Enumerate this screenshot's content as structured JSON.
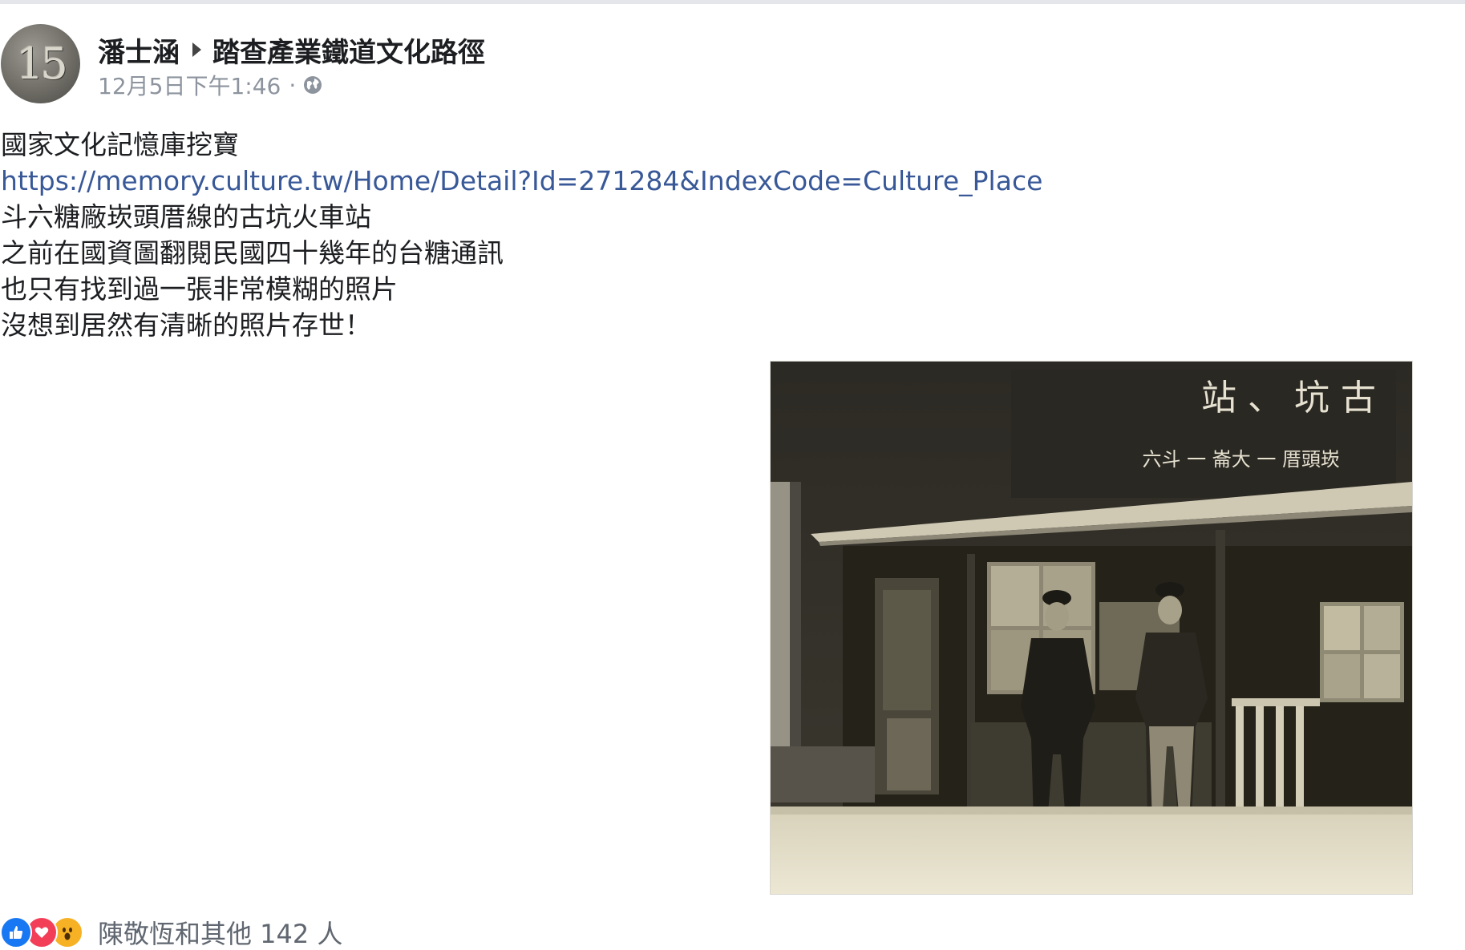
{
  "header": {
    "author": "潘士涵",
    "group": "踏查產業鐵道文化路徑",
    "timestamp": "12月5日下午1:46",
    "separator": "·",
    "privacy_icon": "globe-icon",
    "avatar_text": "15"
  },
  "post": {
    "lines": [
      "國家文化記憶庫挖寶",
      "https://memory.culture.tw/Home/Detail?Id=271284&IndexCode=Culture_Place",
      "斗六糖廠崁頭厝線的古坑火車站",
      "之前在國資圖翻閱民國四十幾年的台糖通訊",
      "也只有找到過一張非常模糊的照片",
      "沒想到居然有清晰的照片存世！"
    ]
  },
  "photo": {
    "sign_main": "站 、 坑 古",
    "sign_sub": "六斗 一 崙大 一 厝頭崁"
  },
  "reactions": {
    "icons": [
      "like-icon",
      "love-icon",
      "wow-icon"
    ],
    "text": "陳敬恆和其他 142 人"
  },
  "colors": {
    "link": "#385898",
    "meta": "#8d949e",
    "like": "#1877f2",
    "love": "#f33e58",
    "wow": "#f7b125"
  }
}
